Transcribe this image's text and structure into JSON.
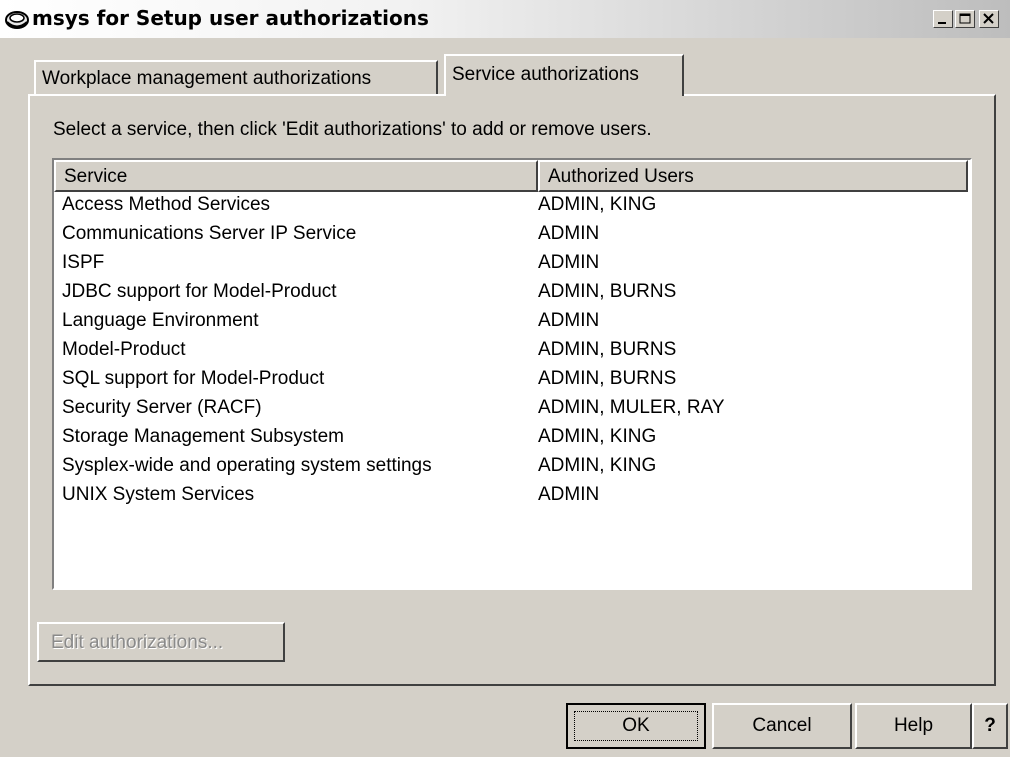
{
  "window": {
    "title": "msys for Setup user authorizations",
    "icon": "msys-app-icon",
    "controls": [
      "minimize-icon",
      "maximize-icon",
      "close-icon"
    ]
  },
  "tabs": [
    {
      "label": "Workplace management authorizations",
      "selected": false
    },
    {
      "label": "Service authorizations",
      "selected": true
    }
  ],
  "instruction": "Select a service, then click 'Edit authorizations' to add or remove users.",
  "table": {
    "columns": [
      "Service",
      "Authorized Users"
    ],
    "rows": [
      {
        "service": "Access Method Services",
        "users": "ADMIN, KING"
      },
      {
        "service": "Communications Server IP Service",
        "users": "ADMIN"
      },
      {
        "service": "ISPF",
        "users": "ADMIN"
      },
      {
        "service": "JDBC support for Model-Product",
        "users": "ADMIN, BURNS"
      },
      {
        "service": "Language Environment",
        "users": "ADMIN"
      },
      {
        "service": "Model-Product",
        "users": "ADMIN, BURNS"
      },
      {
        "service": "SQL support for Model-Product",
        "users": "ADMIN, BURNS"
      },
      {
        "service": "Security Server (RACF)",
        "users": "ADMIN, MULER, RAY"
      },
      {
        "service": "Storage Management Subsystem",
        "users": "ADMIN, KING"
      },
      {
        "service": "Sysplex-wide and operating system settings",
        "users": "ADMIN, KING"
      },
      {
        "service": "UNIX System Services",
        "users": "ADMIN"
      }
    ]
  },
  "buttons": {
    "edit": "Edit authorizations...",
    "ok": "OK",
    "cancel": "Cancel",
    "help": "Help",
    "context_help": "?"
  }
}
